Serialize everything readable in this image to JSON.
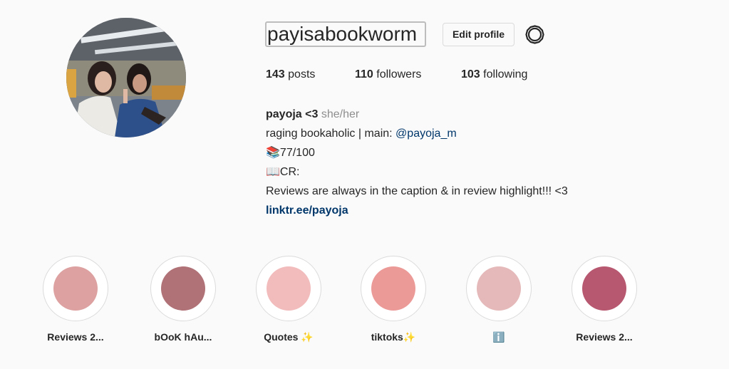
{
  "profile": {
    "username": "payisabookworm",
    "edit_profile_label": "Edit profile",
    "settings_icon": "gear-icon"
  },
  "stats": {
    "posts_count": "143",
    "posts_label": "posts",
    "followers_count": "110",
    "followers_label": "followers",
    "following_count": "103",
    "following_label": "following"
  },
  "bio": {
    "name": "payoja <3",
    "pronouns": "she/her",
    "line1_prefix": "raging bookaholic | main: ",
    "line1_mention": "@payoja_m",
    "line2": "📚77/100",
    "line3": "📖CR:",
    "line4": "Reviews are always in the caption & in review highlight!!! <3",
    "link": "linktr.ee/payoja"
  },
  "highlights": [
    {
      "label": "Reviews 2...",
      "color": "#dca1a0"
    },
    {
      "label": "bOoK hAu...",
      "color": "#b07277"
    },
    {
      "label": "Quotes ✨",
      "color": "#f2bbbc"
    },
    {
      "label": "tiktoks✨",
      "color": "#ec9a98"
    },
    {
      "label": "ℹ️",
      "color": "#e5b9b9"
    },
    {
      "label": "Reviews 2...",
      "color": "#b85870"
    }
  ]
}
